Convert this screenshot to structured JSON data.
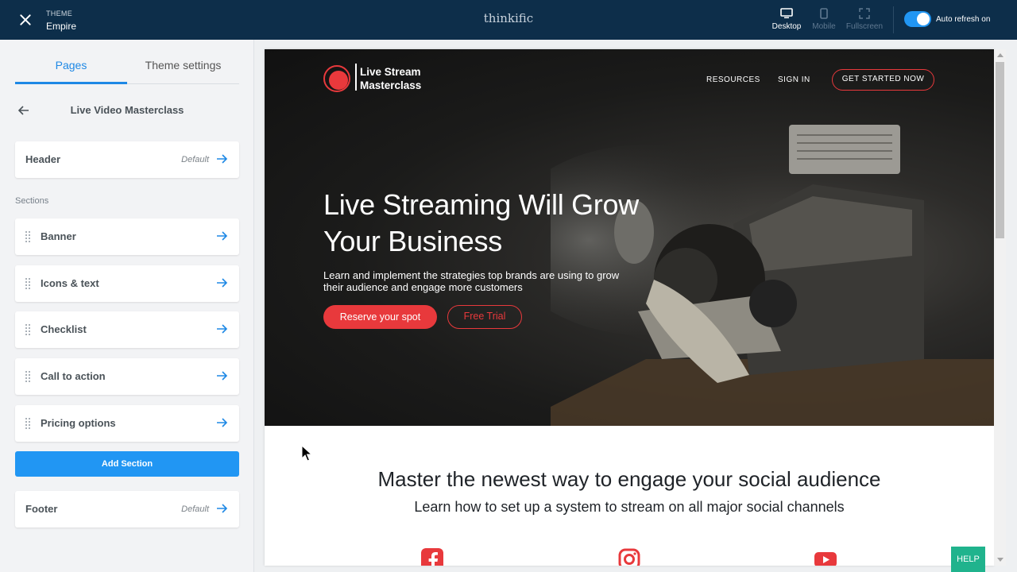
{
  "topbar": {
    "theme_caption": "THEME",
    "theme_name": "Empire",
    "brand": "thinkific",
    "views": [
      {
        "label": "Desktop",
        "icon": "desktop-icon",
        "active": true
      },
      {
        "label": "Mobile",
        "icon": "mobile-icon",
        "active": false
      },
      {
        "label": "Fullscreen",
        "icon": "fullscreen-icon",
        "active": false
      }
    ],
    "auto_refresh_label": "Auto refresh on",
    "auto_refresh_on": true
  },
  "sidebar": {
    "tabs": [
      {
        "label": "Pages",
        "active": true
      },
      {
        "label": "Theme settings",
        "active": false
      }
    ],
    "page_name": "Live Video Masterclass",
    "header": {
      "label": "Header",
      "status": "Default"
    },
    "sections_label": "Sections",
    "sections": [
      {
        "label": "Banner"
      },
      {
        "label": "Icons & text"
      },
      {
        "label": "Checklist"
      },
      {
        "label": "Call to action"
      },
      {
        "label": "Pricing options"
      }
    ],
    "add_section_label": "Add Section",
    "footer": {
      "label": "Footer",
      "status": "Default"
    }
  },
  "preview": {
    "logo_text": "Live Stream Masterclass",
    "nav": {
      "resources": "RESOURCES",
      "sign_in": "SIGN IN",
      "cta": "GET STARTED NOW"
    },
    "hero": {
      "title": "Live Streaming Will Grow Your Business",
      "subtitle": "Learn and implement the strategies top brands are using to grow their audience and engage more customers",
      "primary_button": "Reserve your spot",
      "secondary_button": "Free Trial"
    },
    "section": {
      "title": "Master the newest way to engage your social audience",
      "subtitle": "Learn how to set up a system to stream on all major social channels"
    },
    "social_icons": [
      "facebook-icon",
      "instagram-icon",
      "youtube-icon"
    ]
  },
  "help_label": "HELP",
  "colors": {
    "topbar": "#0d2e4a",
    "accent_blue": "#2196f3",
    "brand_red": "#e8393c",
    "help_green": "#20b38d"
  }
}
